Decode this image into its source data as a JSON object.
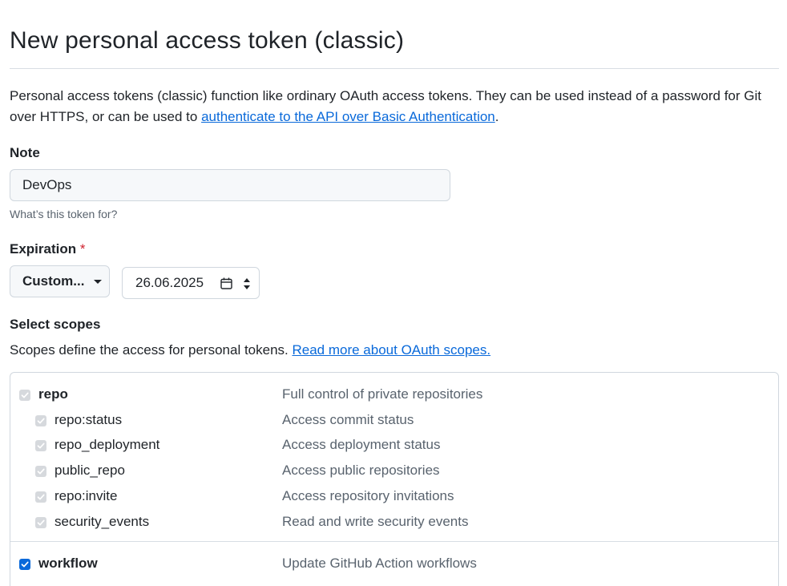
{
  "page": {
    "title": "New personal access token (classic)",
    "description_prefix": "Personal access tokens (classic) function like ordinary OAuth access tokens. They can be used instead of a password for Git over HTTPS, or can be used to ",
    "description_link": "authenticate to the API over Basic Authentication",
    "description_suffix": "."
  },
  "note": {
    "label": "Note",
    "value": "DevOps",
    "hint": "What’s this token for?"
  },
  "expiration": {
    "label": "Expiration",
    "required_marker": "*",
    "selected": "Custom...",
    "date": "26.06.2025"
  },
  "scopes": {
    "label": "Select scopes",
    "description": "Scopes define the access for personal tokens. ",
    "description_link": "Read more about OAuth scopes.",
    "groups": [
      {
        "name": "repo",
        "description": "Full control of private repositories",
        "checked": true,
        "children": [
          {
            "name": "repo:status",
            "description": "Access commit status",
            "checked": true
          },
          {
            "name": "repo_deployment",
            "description": "Access deployment status",
            "checked": true
          },
          {
            "name": "public_repo",
            "description": "Access public repositories",
            "checked": true
          },
          {
            "name": "repo:invite",
            "description": "Access repository invitations",
            "checked": true
          },
          {
            "name": "security_events",
            "description": "Read and write security events",
            "checked": true
          }
        ]
      },
      {
        "name": "workflow",
        "description": "Update GitHub Action workflows",
        "checked": true
      }
    ]
  },
  "colors": {
    "link": "#0969da",
    "checkbox_active": "#0969da",
    "checkbox_disabled": "#d6d9dd",
    "required": "#cf222e"
  }
}
